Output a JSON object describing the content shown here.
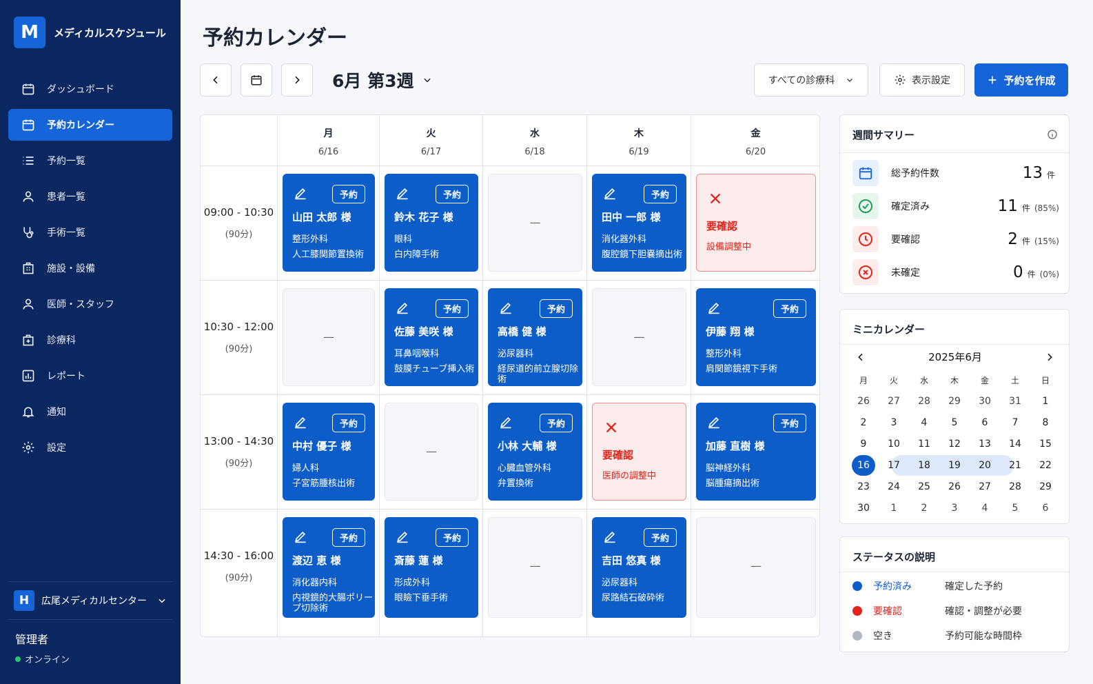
{
  "brand": {
    "logo": "M",
    "name": "メディカルスケジュール"
  },
  "nav": [
    {
      "label": "ダッシュボード",
      "icon": "calendar-icon"
    },
    {
      "label": "予約カレンダー",
      "icon": "calendar-icon",
      "active": true
    },
    {
      "label": "予約一覧",
      "icon": "list-icon"
    },
    {
      "label": "患者一覧",
      "icon": "user-icon"
    },
    {
      "label": "手術一覧",
      "icon": "stethoscope-icon"
    },
    {
      "label": "施設・設備",
      "icon": "building-icon"
    },
    {
      "label": "医師・スタッフ",
      "icon": "user-icon"
    },
    {
      "label": "診療科",
      "icon": "hospital-icon"
    },
    {
      "label": "レポート",
      "icon": "chart-icon"
    },
    {
      "label": "通知",
      "icon": "bell-icon"
    },
    {
      "label": "設定",
      "icon": "gear-icon"
    }
  ],
  "org": {
    "logo": "H",
    "name": "広尾メディカルセンター"
  },
  "user": {
    "role": "管理者",
    "status": "オンライン"
  },
  "page": {
    "title": "予約カレンダー",
    "week_label": "6月 第3週"
  },
  "toolbar": {
    "dept_filter": "すべての診療科",
    "display_settings": "表示設定",
    "create": "予約を作成"
  },
  "colors": {
    "primary": "#1565d8",
    "booked": "#0d5dc9",
    "needs_confirm": "#e2231a",
    "sidebar": "#0b2760",
    "empty": "#b0b8c4"
  },
  "days": [
    {
      "name": "月",
      "date": "6/16"
    },
    {
      "name": "火",
      "date": "6/17"
    },
    {
      "name": "水",
      "date": "6/18"
    },
    {
      "name": "木",
      "date": "6/19"
    },
    {
      "name": "金",
      "date": "6/20"
    }
  ],
  "slots": [
    {
      "time": "09:00 - 10:30",
      "duration": "(90分)"
    },
    {
      "time": "10:30 - 12:00",
      "duration": "(90分)"
    },
    {
      "time": "13:00 - 14:30",
      "duration": "(90分)"
    },
    {
      "time": "14:30 - 16:00",
      "duration": "(90分)"
    }
  ],
  "appointments": [
    [
      {
        "status": "booked",
        "badge": "予約",
        "patient": "山田 太郎 様",
        "dept": "整形外科",
        "procedure": "人工膝関節置換術"
      },
      {
        "status": "booked",
        "badge": "予約",
        "patient": "鈴木 花子 様",
        "dept": "眼科",
        "procedure": "白内障手術"
      },
      {
        "status": "empty",
        "text": "—"
      },
      {
        "status": "booked",
        "badge": "予約",
        "patient": "田中 一郎 様",
        "dept": "消化器外科",
        "procedure": "腹腔鏡下胆嚢摘出術"
      },
      {
        "status": "needs",
        "title": "要確認",
        "note": "設備調整中"
      }
    ],
    [
      {
        "status": "empty",
        "text": "—"
      },
      {
        "status": "booked",
        "badge": "予約",
        "patient": "佐藤 美咲 様",
        "dept": "耳鼻咽喉科",
        "procedure": "鼓膜チューブ挿入術"
      },
      {
        "status": "booked",
        "badge": "予約",
        "patient": "高橋 健 様",
        "dept": "泌尿器科",
        "procedure": "経尿道的前立腺切除術"
      },
      {
        "status": "empty",
        "text": "—"
      },
      {
        "status": "booked",
        "badge": "予約",
        "patient": "伊藤 翔 様",
        "dept": "整形外科",
        "procedure": "肩関節鏡視下手術"
      }
    ],
    [
      {
        "status": "booked",
        "badge": "予約",
        "patient": "中村 優子 様",
        "dept": "婦人科",
        "procedure": "子宮筋腫核出術"
      },
      {
        "status": "empty",
        "text": "—"
      },
      {
        "status": "booked",
        "badge": "予約",
        "patient": "小林 大輔 様",
        "dept": "心臓血管外科",
        "procedure": "弁置換術"
      },
      {
        "status": "needs",
        "title": "要確認",
        "note": "医師の調整中"
      },
      {
        "status": "booked",
        "badge": "予約",
        "patient": "加藤 直樹 様",
        "dept": "脳神経外科",
        "procedure": "脳腫瘍摘出術"
      }
    ],
    [
      {
        "status": "booked",
        "badge": "予約",
        "patient": "渡辺 恵 様",
        "dept": "消化器内科",
        "procedure": "内視鏡的大腸ポリープ切除術"
      },
      {
        "status": "booked",
        "badge": "予約",
        "patient": "斎藤 蓮 様",
        "dept": "形成外科",
        "procedure": "眼瞼下垂手術"
      },
      {
        "status": "empty",
        "text": "—"
      },
      {
        "status": "booked",
        "badge": "予約",
        "patient": "吉田 悠真 様",
        "dept": "泌尿器科",
        "procedure": "尿路結石破砕術"
      },
      {
        "status": "empty",
        "text": "—"
      }
    ]
  ],
  "summary": {
    "title": "週間サマリー",
    "rows": [
      {
        "label": "総予約件数",
        "value": "13",
        "unit": "件",
        "pct": ""
      },
      {
        "label": "確定済み",
        "value": "11",
        "unit": "件",
        "pct": "(85%)"
      },
      {
        "label": "要確認",
        "value": "2",
        "unit": "件",
        "pct": "(15%)"
      },
      {
        "label": "未確定",
        "value": "0",
        "unit": "件",
        "pct": "(0%)"
      }
    ]
  },
  "mini_calendar": {
    "title": "ミニカレンダー",
    "month": "2025年6月",
    "weekdays": [
      "月",
      "火",
      "水",
      "木",
      "金",
      "土",
      "日"
    ],
    "weeks": [
      [
        "26",
        "27",
        "28",
        "29",
        "30",
        "31",
        "1"
      ],
      [
        "2",
        "3",
        "4",
        "5",
        "6",
        "7",
        "8"
      ],
      [
        "9",
        "10",
        "11",
        "12",
        "13",
        "14",
        "15"
      ],
      [
        "16",
        "17",
        "18",
        "19",
        "20",
        "21",
        "22"
      ],
      [
        "23",
        "24",
        "25",
        "26",
        "27",
        "28",
        "29"
      ],
      [
        "30",
        "1",
        "2",
        "3",
        "4",
        "5",
        "6"
      ]
    ],
    "today": "16"
  },
  "legend": {
    "title": "ステータスの説明",
    "items": [
      {
        "name": "予約済み",
        "desc": "確定した予約",
        "color": "#0d5dc9"
      },
      {
        "name": "要確認",
        "desc": "確認・調整が必要",
        "color": "#e2231a"
      },
      {
        "name": "空き",
        "desc": "予約可能な時間枠",
        "color": "#b0b8c4"
      }
    ]
  }
}
